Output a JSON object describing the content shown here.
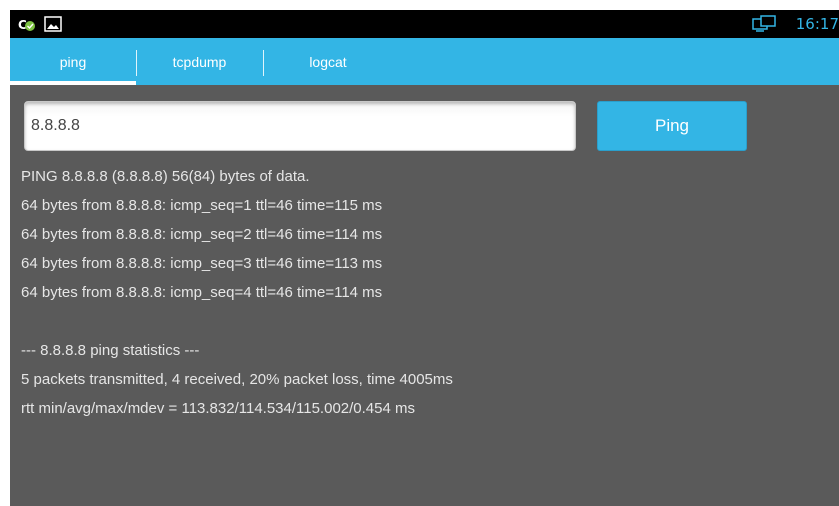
{
  "status_bar": {
    "time": "16:17",
    "icons": [
      "clean-icon",
      "picture-icon",
      "monitor-icon"
    ]
  },
  "tabs": [
    {
      "label": "ping",
      "selected": true
    },
    {
      "label": "tcpdump",
      "selected": false
    },
    {
      "label": "logcat",
      "selected": false
    }
  ],
  "host_input": {
    "value": "8.8.8.8"
  },
  "ping_button": {
    "label": "Ping"
  },
  "output": {
    "lines": [
      "PING 8.8.8.8 (8.8.8.8) 56(84) bytes of data.",
      "64 bytes from 8.8.8.8: icmp_seq=1 ttl=46 time=115 ms",
      "64 bytes from 8.8.8.8: icmp_seq=2 ttl=46 time=114 ms",
      "64 bytes from 8.8.8.8: icmp_seq=3 ttl=46 time=113 ms",
      "64 bytes from 8.8.8.8: icmp_seq=4 ttl=46 time=114 ms",
      "",
      "--- 8.8.8.8 ping statistics ---",
      "5 packets transmitted, 4 received, 20% packet loss, time 4005ms",
      "rtt min/avg/max/mdev = 113.832/114.534/115.002/0.454 ms"
    ]
  },
  "colors": {
    "accent": "#33b5e5",
    "background": "#5a5a5a",
    "status_bar": "#000000",
    "text": "#e6e6e6"
  }
}
